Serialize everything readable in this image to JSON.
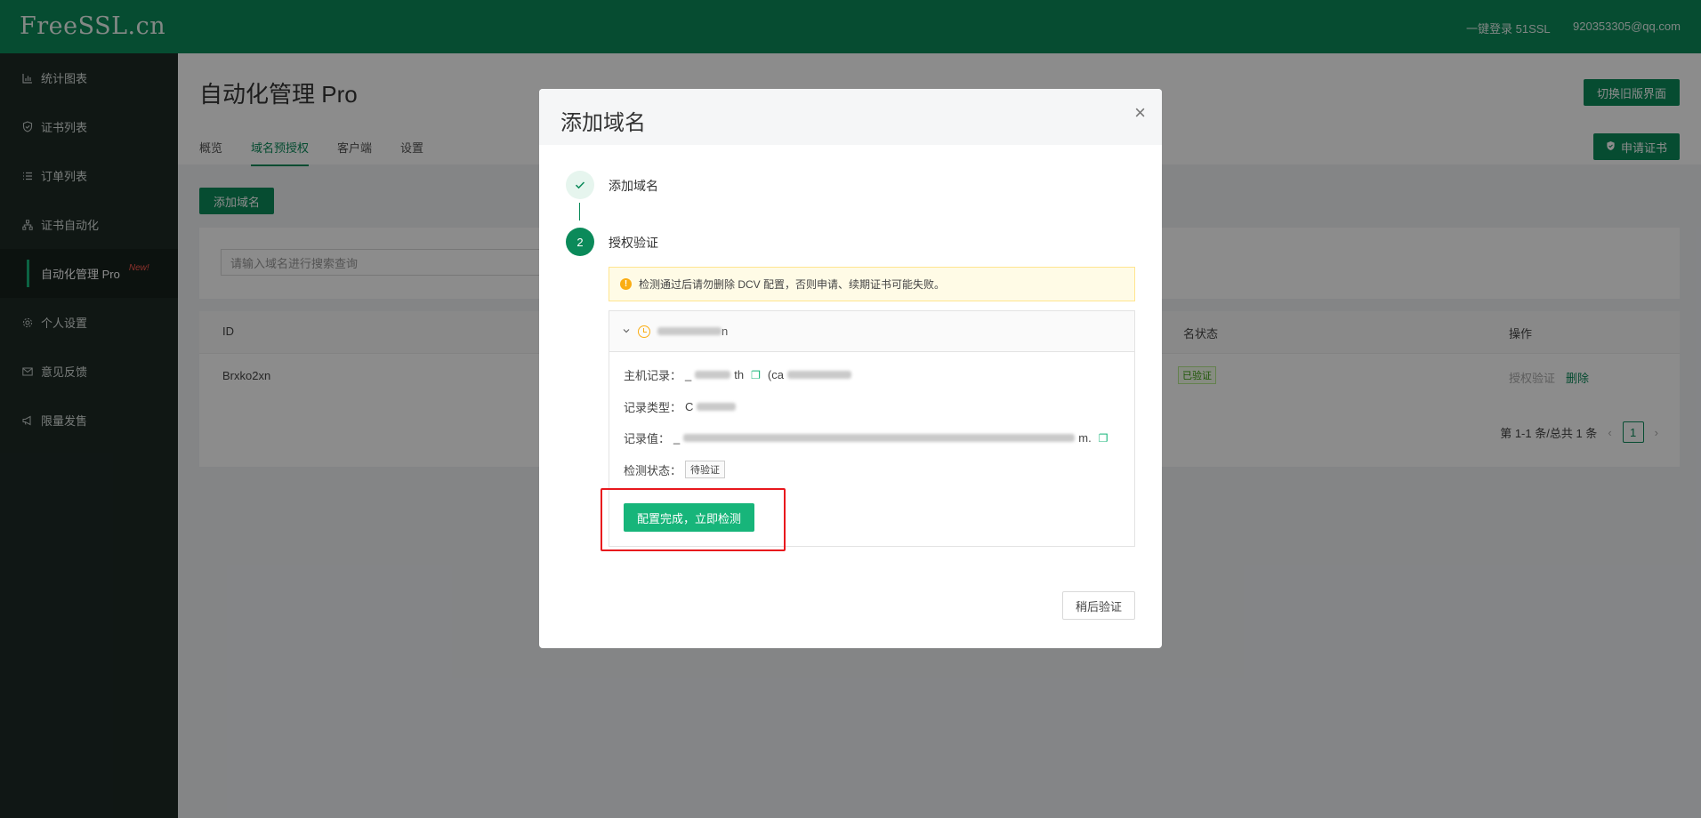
{
  "topbar": {
    "logo": "FreeSSL.cn",
    "login_51ssl": "一键登录 51SSL",
    "user_email": "920353305@qq.com"
  },
  "sidebar": {
    "items": [
      {
        "label": "统计图表",
        "icon": "bar-chart-icon"
      },
      {
        "label": "证书列表",
        "icon": "shield-icon"
      },
      {
        "label": "订单列表",
        "icon": "list-icon"
      },
      {
        "label": "证书自动化",
        "icon": "sitemap-icon"
      },
      {
        "label": "自动化管理 Pro",
        "badge": "New!"
      },
      {
        "label": "个人设置",
        "icon": "gear-icon"
      },
      {
        "label": "意见反馈",
        "icon": "mail-icon"
      },
      {
        "label": "限量发售",
        "icon": "megaphone-icon"
      }
    ]
  },
  "main": {
    "title": "自动化管理 Pro",
    "tabs": [
      "概览",
      "域名预授权",
      "客户端",
      "设置"
    ],
    "active_tab": "域名预授权",
    "switch_old_label": "切换旧版界面",
    "apply_cert_label": "申请证书",
    "add_domain_label": "添加域名",
    "search_placeholder": "请输入域名进行搜索查询",
    "table": {
      "col_id": "ID",
      "col_status": "名状态",
      "col_ops": "操作",
      "row_id": "Brxko2xn",
      "row_status": "已验证",
      "op_verify": "授权验证",
      "op_delete": "删除"
    },
    "pagination": {
      "summary": "第 1-1 条/总共 1 条",
      "current_page": "1"
    }
  },
  "modal": {
    "title": "添加域名",
    "close": "×",
    "steps": [
      {
        "label": "添加域名",
        "state": "done"
      },
      {
        "label": "授权验证",
        "number": "2",
        "state": "active"
      }
    ],
    "alert": "检测通过后请勿删除 DCV 配置，否则申请、续期证书可能失败。",
    "domain_suffix": "n",
    "host_record_label": "主机记录：",
    "host_record_prefix": "_",
    "host_record_mid": "th",
    "host_record_paren": "(ca",
    "record_type_label": "记录类型：",
    "record_type_prefix": "C",
    "record_value_label": "记录值：",
    "record_value_prefix": "_",
    "record_value_suffix": "m.",
    "status_label": "检测状态：",
    "status_value": "待验证",
    "check_button": "配置完成，立即检测",
    "later_button": "稍后验证"
  },
  "colors": {
    "brand": "#0b8a5a",
    "accent": "#17b57a",
    "highlight": "#e8171d"
  }
}
